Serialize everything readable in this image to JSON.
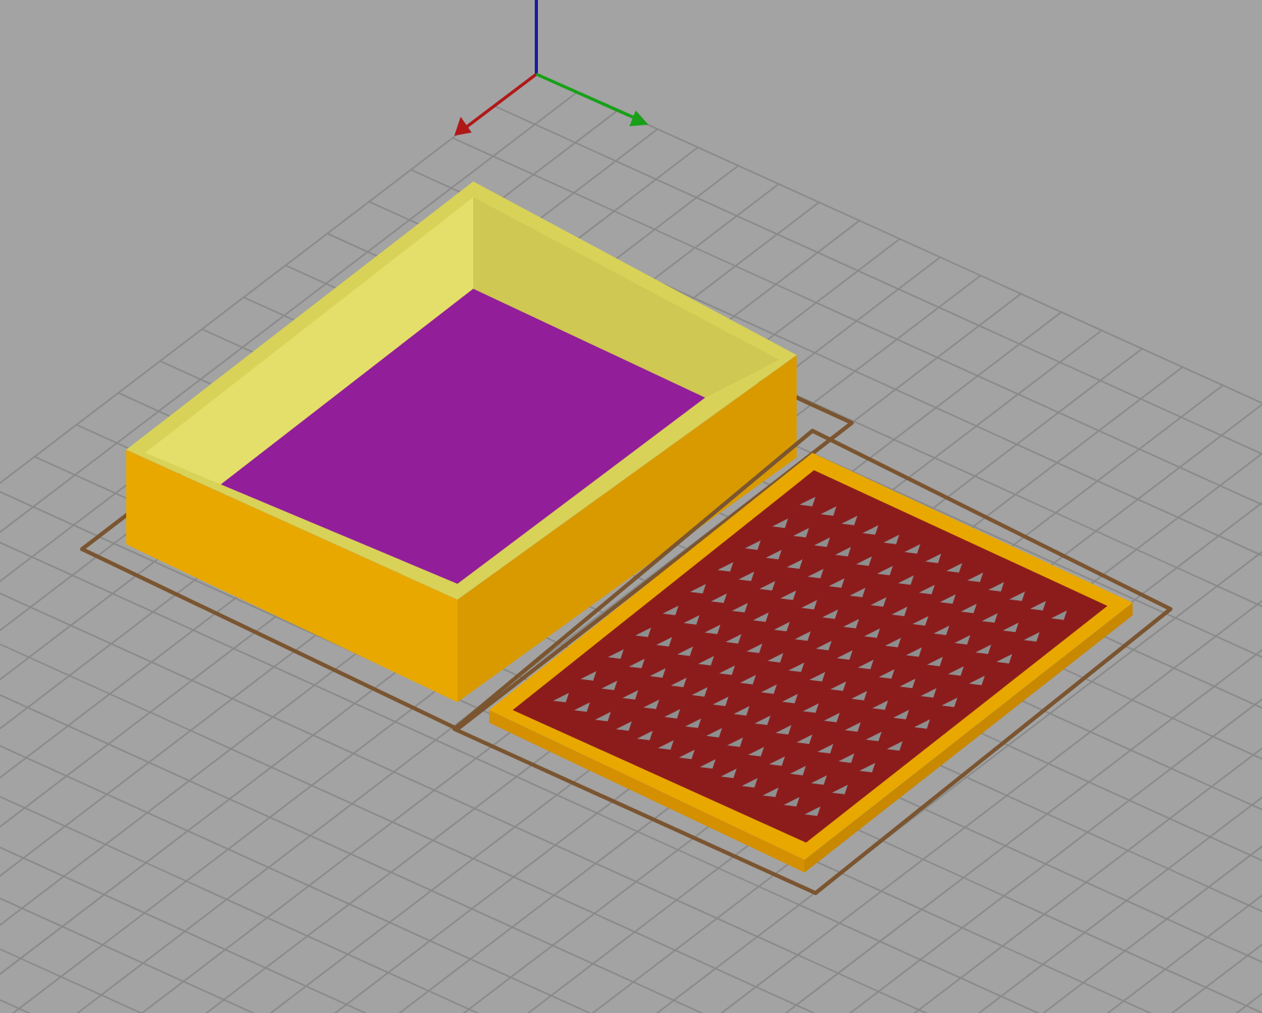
{
  "viewport": {
    "objects": [
      {
        "kind": "box"
      },
      {
        "kind": "lid"
      }
    ]
  }
}
